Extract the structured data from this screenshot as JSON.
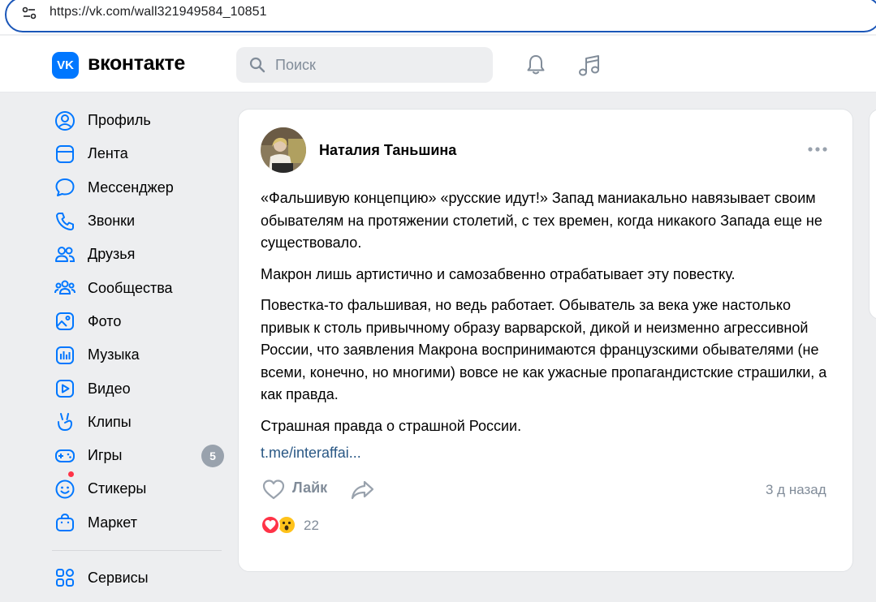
{
  "browser": {
    "url": "https://vk.com/wall321949584_10851"
  },
  "header": {
    "logo_mark": "VK",
    "logo_text": "вконтакте",
    "search_placeholder": "Поиск"
  },
  "sidebar": {
    "items": [
      {
        "label": "Профиль",
        "icon": "profile-icon"
      },
      {
        "label": "Лента",
        "icon": "feed-icon"
      },
      {
        "label": "Мессенджер",
        "icon": "messenger-icon"
      },
      {
        "label": "Звонки",
        "icon": "phone-icon"
      },
      {
        "label": "Друзья",
        "icon": "friends-icon"
      },
      {
        "label": "Сообщества",
        "icon": "communities-icon"
      },
      {
        "label": "Фото",
        "icon": "photo-icon"
      },
      {
        "label": "Музыка",
        "icon": "music-icon"
      },
      {
        "label": "Видео",
        "icon": "video-icon"
      },
      {
        "label": "Клипы",
        "icon": "clips-icon"
      },
      {
        "label": "Игры",
        "icon": "games-icon",
        "badge": "5"
      },
      {
        "label": "Стикеры",
        "icon": "stickers-icon"
      },
      {
        "label": "Маркет",
        "icon": "market-icon"
      }
    ],
    "services_label": "Сервисы"
  },
  "post": {
    "author": "Наталия Таньшина",
    "paragraphs": [
      "«Фальшивую концепцию» «русские идут!» Запад маниакально навязывает своим обывателям на протяжении столетий, с тех времен, когда никакого Запада еще не существовало.",
      "Макрон лишь артистично и самозабвенно отрабатывает эту повестку.",
      "Повестка-то фальшивая, но ведь работает. Обыватель за века уже настолько привык к столь привычному образу варварской, дикой и неизменно агрессивной России, что заявления Макрона воспринимаются французскими обывателями (не всеми, конечно, но многими) вовсе не как ужасные пропагандистские страшилки, а как правда.",
      "Страшная правда о страшной России."
    ],
    "link": "t.me/interaffai...",
    "like_label": "Лайк",
    "time": "3 д назад",
    "reactions_count": "22"
  },
  "colors": {
    "accent": "#0077ff",
    "link": "#2a5885",
    "secondary_text": "#818c99",
    "background": "#edeef0",
    "badge": "#99a2ad"
  }
}
